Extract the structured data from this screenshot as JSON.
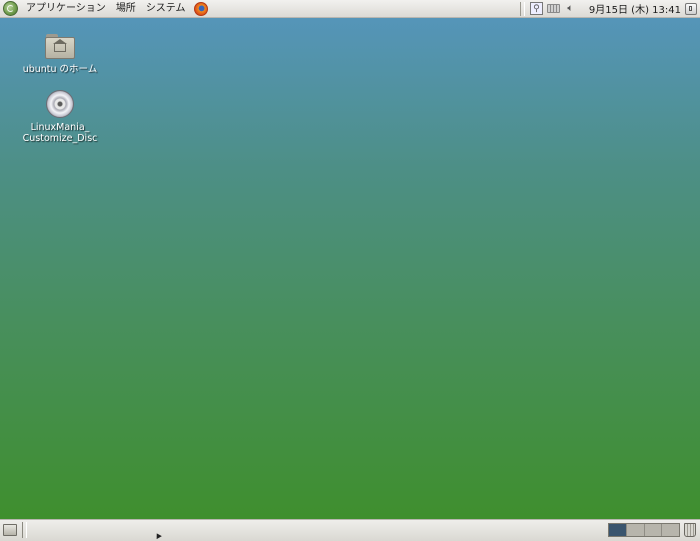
{
  "top_panel": {
    "menus": [
      {
        "label": "アプリケーション"
      },
      {
        "label": "場所"
      },
      {
        "label": "システム"
      }
    ],
    "launchers": [
      "firefox-icon"
    ],
    "tray_icons": [
      "search-icon",
      "keyboard-icon",
      "volume-icon"
    ],
    "clock": "9月15日 (木) 13:41"
  },
  "desktop": {
    "icons": [
      {
        "label": "ubuntu のホーム",
        "icon": "home-folder-icon"
      },
      {
        "label_lines": [
          "LinuxMania_",
          "Customize_Disc"
        ],
        "icon": "disc-icon"
      }
    ]
  },
  "bottom_panel": {
    "workspaces": 4,
    "active_workspace": 1
  },
  "colors": {
    "desktop_top": "#5595b9",
    "desktop_bottom": "#3f8f2e",
    "panel": "#e6e4df",
    "active_workspace": "#3a556e"
  }
}
